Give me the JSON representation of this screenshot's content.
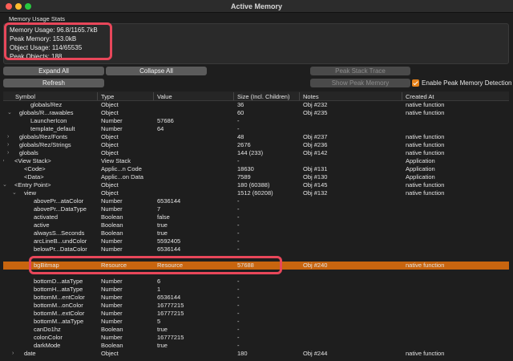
{
  "window": {
    "title": "Active Memory"
  },
  "stats": {
    "heading": "Memory Usage Stats",
    "lines": [
      "Memory Usage: 96.8/1165.7kB",
      "Peak Memory: 153.0kB",
      "Object Usage: 114/65535",
      "Peak Objects: 188"
    ]
  },
  "toolbar": {
    "expand_all": "Expand All",
    "collapse_all": "Collapse All",
    "refresh": "Refresh",
    "peak_stack_trace": "Peak Stack Trace",
    "show_peak_memory": "Show Peak Memory",
    "enable_peak_label": "Enable Peak Memory Detection"
  },
  "table": {
    "columns": [
      "Symbol",
      "Type",
      "Value",
      "Size (Incl. Children)",
      "Notes",
      "Created At"
    ],
    "rows": [
      {
        "chev": "",
        "symbol": "globals/Rez",
        "type": "Object",
        "value": "",
        "size": "36",
        "notes": "Obj #232",
        "created": "native function"
      },
      {
        "chev": "⌄",
        "symbol": "globals/R...rawables",
        "type": "Object",
        "value": "",
        "size": "60",
        "notes": "Obj #235",
        "created": "native function"
      },
      {
        "chev": "",
        "symbol": "LauncherIcon",
        "type": "Number",
        "value": "57686",
        "size": "-",
        "notes": "",
        "created": ""
      },
      {
        "chev": "",
        "symbol": "template_default",
        "type": "Number",
        "value": "64",
        "size": "-",
        "notes": "",
        "created": ""
      },
      {
        "chev": "›",
        "symbol": "globals/Rez/Fonts",
        "type": "Object",
        "value": "",
        "size": "48",
        "notes": "Obj #237",
        "created": "native function"
      },
      {
        "chev": "›",
        "symbol": "globals/Rez/Strings",
        "type": "Object",
        "value": "",
        "size": "2676",
        "notes": "Obj #236",
        "created": "native function"
      },
      {
        "chev": "›",
        "symbol": "globals",
        "type": "Object",
        "value": "",
        "size": "144 (233)",
        "notes": "Obj #142",
        "created": "native function"
      },
      {
        "chev": "›",
        "symbol": "<View Stack>",
        "type": "View Stack",
        "value": "",
        "size": "-",
        "notes": "",
        "created": "Application"
      },
      {
        "chev": "",
        "symbol": "<Code>",
        "type": "Applic...n Code",
        "value": "",
        "size": "18630",
        "notes": "Obj #131",
        "created": "Application"
      },
      {
        "chev": "",
        "symbol": "<Data>",
        "type": "Applic...on Data",
        "value": "",
        "size": "7589",
        "notes": "Obj #130",
        "created": "Application"
      },
      {
        "chev": "⌄",
        "symbol": "<Entry Point>",
        "type": "Object",
        "value": "",
        "size": "180 (60388)",
        "notes": "Obj #145",
        "created": "native function"
      },
      {
        "chev": "⌄",
        "symbol": "view",
        "type": "Object",
        "value": "",
        "size": "1512 (60208)",
        "notes": "Obj #132",
        "created": "native function"
      },
      {
        "chev": "",
        "symbol": "abovePr...ataColor",
        "type": "Number",
        "value": "6536144",
        "size": "-",
        "notes": "",
        "created": ""
      },
      {
        "chev": "",
        "symbol": "abovePr...DataType",
        "type": "Number",
        "value": "7",
        "size": "-",
        "notes": "",
        "created": ""
      },
      {
        "chev": "",
        "symbol": "activated",
        "type": "Boolean",
        "value": "false",
        "size": "-",
        "notes": "",
        "created": ""
      },
      {
        "chev": "",
        "symbol": "active",
        "type": "Boolean",
        "value": "true",
        "size": "-",
        "notes": "",
        "created": ""
      },
      {
        "chev": "",
        "symbol": "alwaysS...Seconds",
        "type": "Boolean",
        "value": "true",
        "size": "-",
        "notes": "",
        "created": ""
      },
      {
        "chev": "",
        "symbol": "arcLineB...undColor",
        "type": "Number",
        "value": "5592405",
        "size": "-",
        "notes": "",
        "created": ""
      },
      {
        "chev": "",
        "symbol": "belowPr...DataColor",
        "type": "Number",
        "value": "6536144",
        "size": "-",
        "notes": "",
        "created": ""
      },
      {
        "chev": "",
        "symbol": "",
        "type": "",
        "value": "",
        "size": "",
        "notes": "",
        "created": ""
      },
      {
        "chev": "",
        "symbol": "bgBitmap",
        "type": "Resource",
        "value": "Resource",
        "size": "57688",
        "notes": "Obj #240",
        "created": "native function",
        "selected": true
      },
      {
        "chev": "",
        "symbol": "",
        "type": "",
        "value": "",
        "size": "",
        "notes": "",
        "created": ""
      },
      {
        "chev": "",
        "symbol": "bottomD...ataType",
        "type": "Number",
        "value": "6",
        "size": "-",
        "notes": "",
        "created": ""
      },
      {
        "chev": "",
        "symbol": "bottomH...ataType",
        "type": "Number",
        "value": "1",
        "size": "-",
        "notes": "",
        "created": ""
      },
      {
        "chev": "",
        "symbol": "bottomM...entColor",
        "type": "Number",
        "value": "6536144",
        "size": "-",
        "notes": "",
        "created": ""
      },
      {
        "chev": "",
        "symbol": "bottomM...onColor",
        "type": "Number",
        "value": "16777215",
        "size": "-",
        "notes": "",
        "created": ""
      },
      {
        "chev": "",
        "symbol": "bottomM...extColor",
        "type": "Number",
        "value": "16777215",
        "size": "-",
        "notes": "",
        "created": ""
      },
      {
        "chev": "",
        "symbol": "bottomM...ataType",
        "type": "Number",
        "value": "5",
        "size": "-",
        "notes": "",
        "created": ""
      },
      {
        "chev": "",
        "symbol": "canDo1hz",
        "type": "Boolean",
        "value": "true",
        "size": "-",
        "notes": "",
        "created": ""
      },
      {
        "chev": "",
        "symbol": "colonColor",
        "type": "Number",
        "value": "16777215",
        "size": "-",
        "notes": "",
        "created": ""
      },
      {
        "chev": "",
        "symbol": "darkMode",
        "type": "Boolean",
        "value": "true",
        "size": "-",
        "notes": "",
        "created": ""
      },
      {
        "chev": "›",
        "symbol": "date",
        "type": "Object",
        "value": "",
        "size": "180",
        "notes": "Obj #244",
        "created": "native function"
      }
    ]
  },
  "colors": {
    "accent": "#c8650f",
    "highlight": "#e8475a"
  }
}
